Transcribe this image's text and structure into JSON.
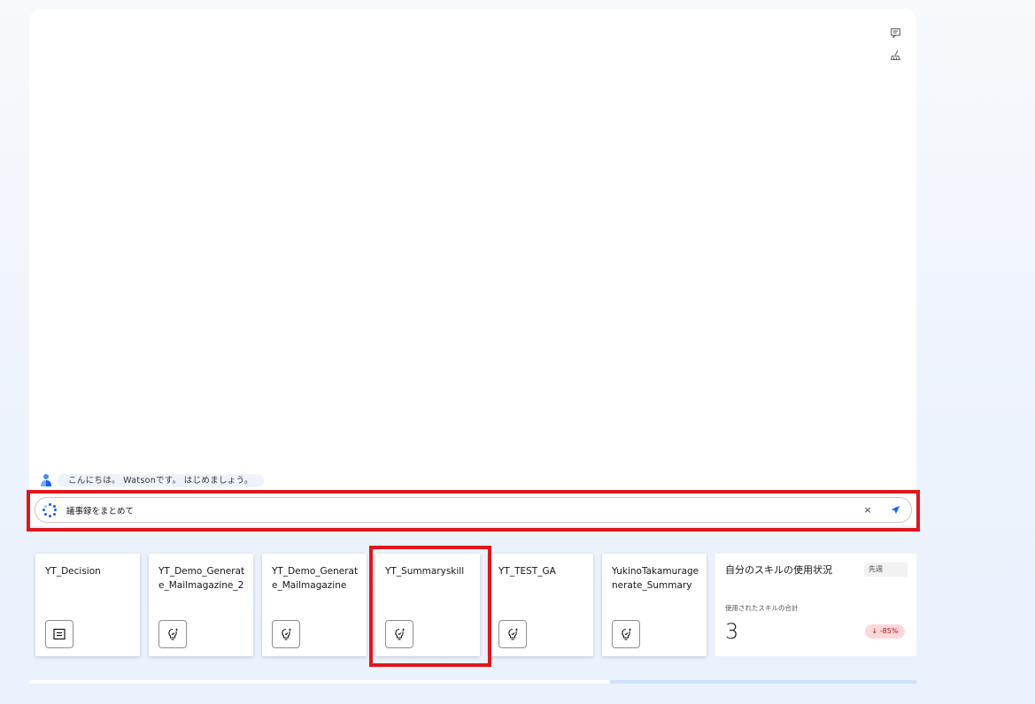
{
  "chat": {
    "greeting": "こんにちは。 Watsonです。 はじめましょう。",
    "input_value": "議事録をまとめて",
    "clear_glyph": "×"
  },
  "skills": [
    {
      "name": "YT_Decision",
      "icon": "document-icon"
    },
    {
      "name": "YT_Demo_Generate_Mailmagazine_2",
      "icon": "lightbulb-sparkle-icon"
    },
    {
      "name": "YT_Demo_Generate_Mailmagazine",
      "icon": "lightbulb-sparkle-icon"
    },
    {
      "name": "YT_Summaryskill",
      "icon": "lightbulb-sparkle-icon"
    },
    {
      "name": "YT_TEST_GA",
      "icon": "lightbulb-sparkle-icon"
    },
    {
      "name": "YukinoTakamuragenerate_Summary",
      "icon": "lightbulb-sparkle-icon"
    }
  ],
  "usage": {
    "title": "自分のスキルの使用状況",
    "period": "先週",
    "subtitle": "使用されたスキルの合計",
    "count": "3",
    "delta": "↓ -85%"
  },
  "progress": {
    "start_fraction": 0.655,
    "end_fraction": 1.0
  },
  "colors": {
    "accent": "#0f62fe",
    "highlight": "#e0161e",
    "negative_badge_bg": "#ffd7d9",
    "negative_badge_text": "#a2191f"
  }
}
